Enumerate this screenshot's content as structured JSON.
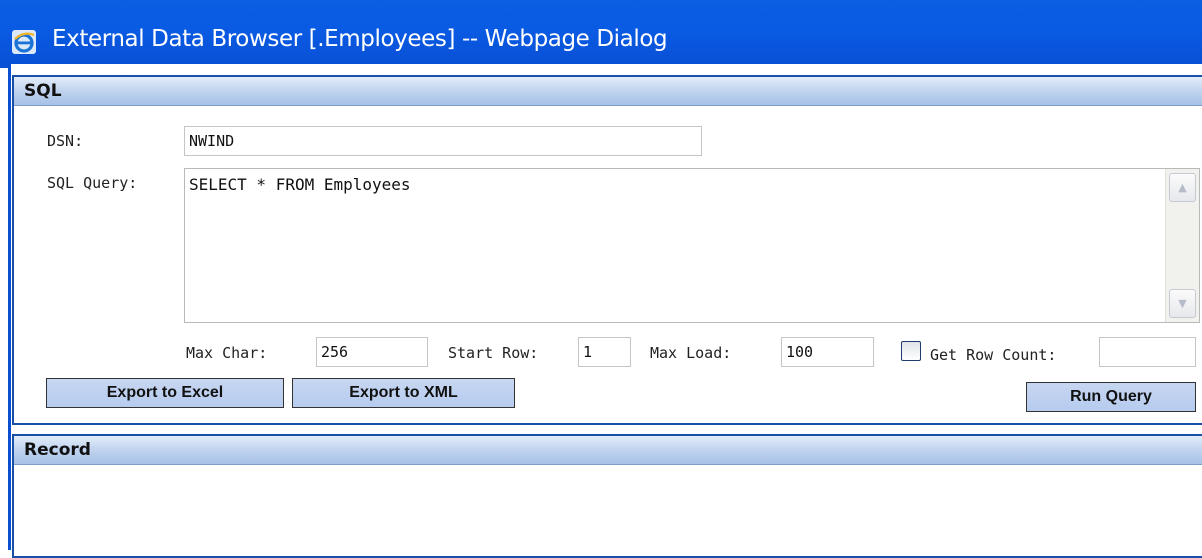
{
  "window": {
    "title": "External Data Browser [.Employees] -- Webpage Dialog",
    "icon": "internet-explorer-icon"
  },
  "sql_section": {
    "header": "SQL",
    "dsn_label": "DSN:",
    "dsn_value": "NWIND",
    "query_label": "SQL Query:",
    "query_value": "SELECT * FROM Employees",
    "max_char_label": "Max Char:",
    "max_char_value": "256",
    "start_row_label": "Start Row:",
    "start_row_value": "1",
    "max_load_label": "Max Load:",
    "max_load_value": "100",
    "get_row_count_label": "Get Row Count:",
    "get_row_count_checked": false,
    "get_row_count_value": "",
    "export_excel_label": "Export to Excel",
    "export_xml_label": "Export to XML",
    "run_query_label": "Run Query"
  },
  "record_section": {
    "header": "Record"
  }
}
